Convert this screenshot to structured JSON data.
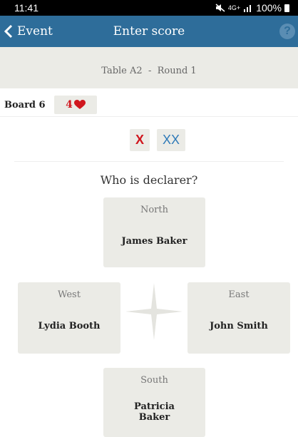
{
  "status_bar": {
    "time": "11:41",
    "network": "4G+",
    "battery": "100%"
  },
  "appbar": {
    "back_label": "Event",
    "title": "Enter score",
    "help_glyph": "?"
  },
  "subheader": {
    "table": "Table A2",
    "separator": "-",
    "round": "Round 1"
  },
  "board": {
    "label": "Board 6",
    "contract_level": "4",
    "contract_suit": "heart-icon",
    "suit_color": "#d0161e"
  },
  "doubles": {
    "double_label": "X",
    "redouble_label": "XX"
  },
  "question": "Who is declarer?",
  "seats": {
    "north": {
      "direction": "North",
      "player": "James Baker"
    },
    "west": {
      "direction": "West",
      "player": "Lydia Booth"
    },
    "east": {
      "direction": "East",
      "player": "John Smith"
    },
    "south": {
      "direction": "South",
      "player": "Patricia Baker"
    }
  },
  "colors": {
    "appbar": "#2e6d9a",
    "panel": "#ebebe6",
    "accent_red": "#d0161e",
    "accent_blue": "#2f7ab8"
  }
}
